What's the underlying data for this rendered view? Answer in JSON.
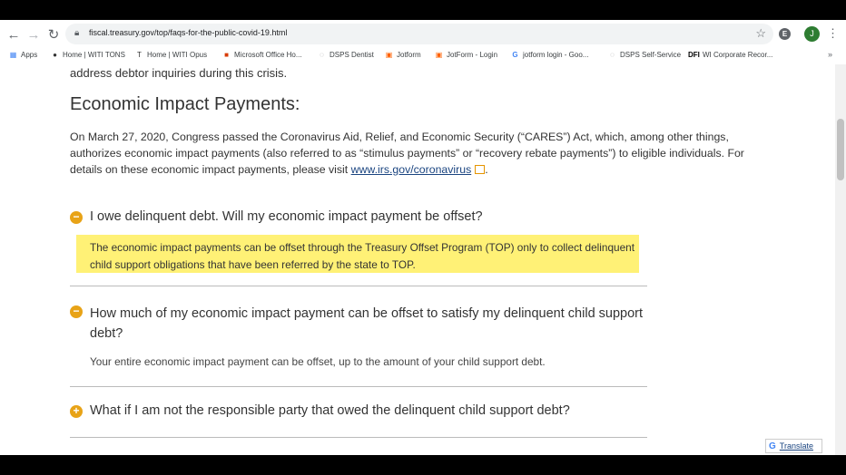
{
  "browser": {
    "url": "fiscal.treasury.gov/top/faqs-for-the-public-covid-19.html",
    "profile_initial": "J",
    "extension_label": "E"
  },
  "bookmarks": [
    {
      "label": "Apps",
      "icon": "apps-icon"
    },
    {
      "label": "Home | WITI TONS",
      "icon": "globe-icon"
    },
    {
      "label": "Home | WITI Opus",
      "icon": "t-icon"
    },
    {
      "label": "Microsoft Office Ho...",
      "icon": "office-icon"
    },
    {
      "label": "DSPS Dentist",
      "icon": "loading-icon"
    },
    {
      "label": "Jotform",
      "icon": "jotform-icon"
    },
    {
      "label": "JotForm - Login",
      "icon": "jotform-icon"
    },
    {
      "label": "jotform login - Goo...",
      "icon": "google-icon"
    },
    {
      "label": "DSPS Self-Service",
      "icon": "loading-icon"
    },
    {
      "label": "WI Corporate Recor...",
      "icon": "dfi-icon"
    }
  ],
  "bookmarks_more": "»",
  "content": {
    "clipped_text": "address debtor inquiries during this crisis.",
    "section_title": "Economic Impact Payments:",
    "intro_text": "On March 27, 2020, Congress passed the Coronavirus Aid, Relief, and Economic Security (“CARES”) Act, which, among other things, authorizes economic impact payments (also referred to as “stimulus payments” or “recovery rebate payments”) to eligible individuals. For details on these economic impact payments, please visit ",
    "intro_link": "www.irs.gov/coronavirus",
    "intro_end": ".",
    "faqs": [
      {
        "question": "I owe delinquent debt. Will my economic impact payment be offset?",
        "state": "expanded",
        "answer": "The economic impact payments can be offset through the Treasury Offset Program (TOP) only to collect delinquent child support obligations that have been referred by the state to TOP."
      },
      {
        "question": "How much of my economic impact payment can be offset to satisfy my delinquent child support debt?",
        "state": "expanded",
        "answer": "Your entire economic impact payment can be offset, up to the amount of your child support debt."
      },
      {
        "question": "What if I am not the responsible party that owed the delinquent child support debt?",
        "state": "collapsed",
        "answer": ""
      }
    ],
    "icon_expanded": "−",
    "icon_collapsed": "+"
  },
  "translate": {
    "g": "G",
    "label": "Translate"
  },
  "colors": {
    "highlight": "#fff176",
    "accent": "#e8a317",
    "link": "#1a4480"
  }
}
